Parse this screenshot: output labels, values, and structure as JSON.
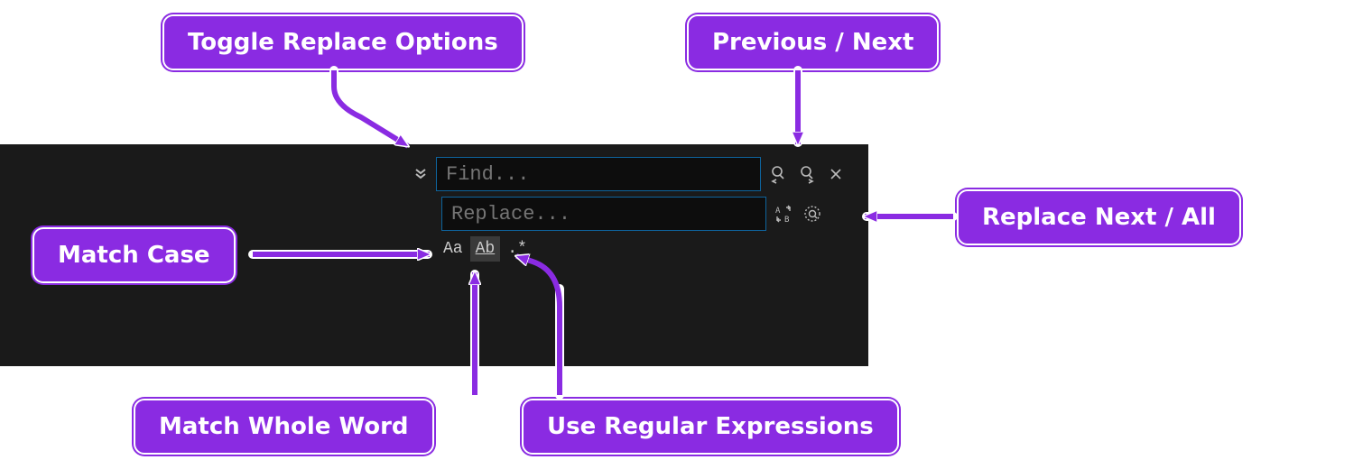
{
  "find_replace": {
    "find_placeholder": "Find...",
    "replace_placeholder": "Replace...",
    "options": {
      "match_case_label": "Aa",
      "whole_word_label": "Ab",
      "regex_label": ".*"
    }
  },
  "callouts": {
    "toggle_replace": "Toggle Replace Options",
    "prev_next": "Previous / Next",
    "match_case": "Match Case",
    "replace_next_all": "Replace Next / All",
    "match_whole_word": "Match Whole Word",
    "use_regex": "Use Regular Expressions"
  },
  "colors": {
    "callout_bg": "#8a2be2",
    "panel_bg": "#1a1a1a",
    "input_border": "#0e639c"
  }
}
